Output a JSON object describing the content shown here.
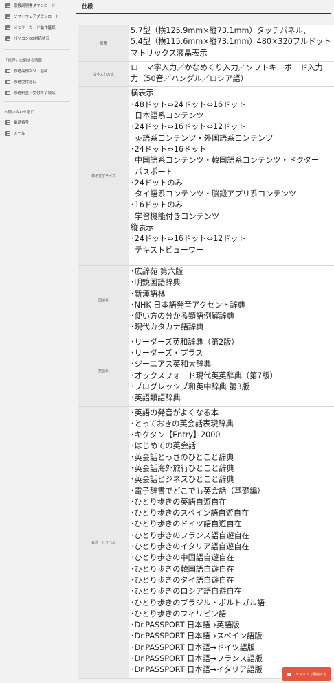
{
  "sidebar": {
    "top_items": [
      {
        "label": "取扱説明書ダウンロード",
        "icon": "document-icon"
      },
      {
        "label": "ソフトウェアダウンロード",
        "icon": "download-icon"
      },
      {
        "label": "メモリーカード動作確認",
        "icon": "memory-card-icon"
      },
      {
        "label": "パソコンOS対応状況",
        "icon": "computer-icon"
      }
    ],
    "section2_title": "「修理」に関する情報",
    "section2_items": [
      {
        "label": "修理品預かり・返却",
        "icon": "wrench-icon"
      },
      {
        "label": "修理受付窓口",
        "icon": "service-icon"
      },
      {
        "label": "修理料金／受付終了製品",
        "icon": "list-icon"
      }
    ],
    "section3_title": "お問い合わせ窓口",
    "section3_items": [
      {
        "label": "電話番号",
        "icon": "phone-icon"
      },
      {
        "label": "メール",
        "icon": "mail-icon"
      }
    ]
  },
  "header": {
    "title": "仕様"
  },
  "spec": {
    "rows": [
      {
        "label": "画面",
        "lines": [
          {
            "text": "5.7型（横125.9mm×縦73.1mm）タッチパネル、"
          },
          {
            "text": "5.4型（横115.6mm×縦73.1mm）480×320フルドット"
          },
          {
            "text": "マトリックス液晶表示"
          }
        ]
      },
      {
        "label": "文字入力方式",
        "lines": [
          {
            "text": "ローマ字入力／かなめくり入力／ソフトキーボード入力"
          },
          {
            "text": "力（50音／ハングル／ロシア語）"
          }
        ]
      },
      {
        "label": "表示文字サイズ",
        "lines": [
          {
            "text": "横表示"
          },
          {
            "text": "･48ドット⇔24ドット⇔16ドット"
          },
          {
            "text": "日本語系コンテンツ",
            "indent": true
          },
          {
            "text": "･24ドット⇔16ドット⇔12ドット"
          },
          {
            "text": "英語系コンテンツ・外国語系コンテンツ",
            "indent": true
          },
          {
            "text": "･24ドット⇔16ドット"
          },
          {
            "text": "中国語系コンテンツ・韓国語系コンテンツ・ドクター",
            "indent": true
          },
          {
            "text": "パスポート",
            "indent": true
          },
          {
            "text": "･24ドットのみ"
          },
          {
            "text": "タイ語系コンテンツ・脳鍛アプリ系コンテンツ",
            "indent": true
          },
          {
            "text": "･16ドットのみ"
          },
          {
            "text": "学習機能付きコンテンツ",
            "indent": true
          },
          {
            "text": "縦表示"
          },
          {
            "text": "･24ドット⇔16ドット⇔12ドット"
          },
          {
            "text": "テキストビューワー",
            "indent": true
          },
          {
            "text": ""
          }
        ]
      },
      {
        "label": "国語系",
        "lines": [
          {
            "text": "･広辞苑 第六版"
          },
          {
            "text": "･明鏡国語辞典"
          },
          {
            "text": "･新漢語林"
          },
          {
            "text": "･NHK 日本語発音アクセント辞典"
          },
          {
            "text": "･使い方の分かる類語例解辞典"
          },
          {
            "text": "･現代カタカナ語辞典"
          }
        ]
      },
      {
        "label": "英語系",
        "lines": [
          {
            "text": "･リーダーズ英和辞典（第2版）"
          },
          {
            "text": "･リーダーズ・プラス"
          },
          {
            "text": "･ジーニアス英和大辞典"
          },
          {
            "text": "･オックスフォード現代英英辞典（第7版）"
          },
          {
            "text": "･プログレッシブ和英中辞典 第3版"
          },
          {
            "text": "･英語類語辞典"
          }
        ]
      },
      {
        "label": "会話・トラベル",
        "lines": [
          {
            "text": "･英語の発音がよくなる本"
          },
          {
            "text": "･とっておきの英会話表現辞典"
          },
          {
            "text": "･キクタン【Entry】2000"
          },
          {
            "text": "･はじめての英会話"
          },
          {
            "text": "･英会話とっさのひとこと辞典"
          },
          {
            "text": "･英会話海外旅行ひとこと辞典"
          },
          {
            "text": "･英会話ビジネスひとこと辞典"
          },
          {
            "text": "･電子辞書でどこでも英会話（基礎編）"
          },
          {
            "text": "･ひとり歩きの英語自遊自在"
          },
          {
            "text": "･ひとり歩きのスペイン語自遊自在"
          },
          {
            "text": "･ひとり歩きのドイツ語自遊自在"
          },
          {
            "text": "･ひとり歩きのフランス語自遊自在"
          },
          {
            "text": "･ひとり歩きのイタリア語自遊自在"
          },
          {
            "text": "･ひとり歩きの中国語自遊自在"
          },
          {
            "text": "･ひとり歩きの韓国語自遊自在"
          },
          {
            "text": "･ひとり歩きのタイ語自遊自在"
          },
          {
            "text": "･ひとり歩きのロシア語自遊自在"
          },
          {
            "text": "･ひとり歩きのブラジル・ポルトガル語"
          },
          {
            "text": "･ひとり歩きのフィリピン語"
          },
          {
            "text": "･Dr.PASSPORT 日本語→英語版"
          },
          {
            "text": "･Dr.PASSPORT 日本語→スペイン語版"
          },
          {
            "text": "･Dr.PASSPORT 日本語→ドイツ語版"
          },
          {
            "text": "･Dr.PASSPORT 日本語→フランス語版"
          },
          {
            "text": "･Dr.PASSPORT 日本語→イタリア語版"
          }
        ]
      }
    ]
  },
  "chat_button": {
    "label": "チャットで相談する",
    "color": "#e2573f"
  }
}
